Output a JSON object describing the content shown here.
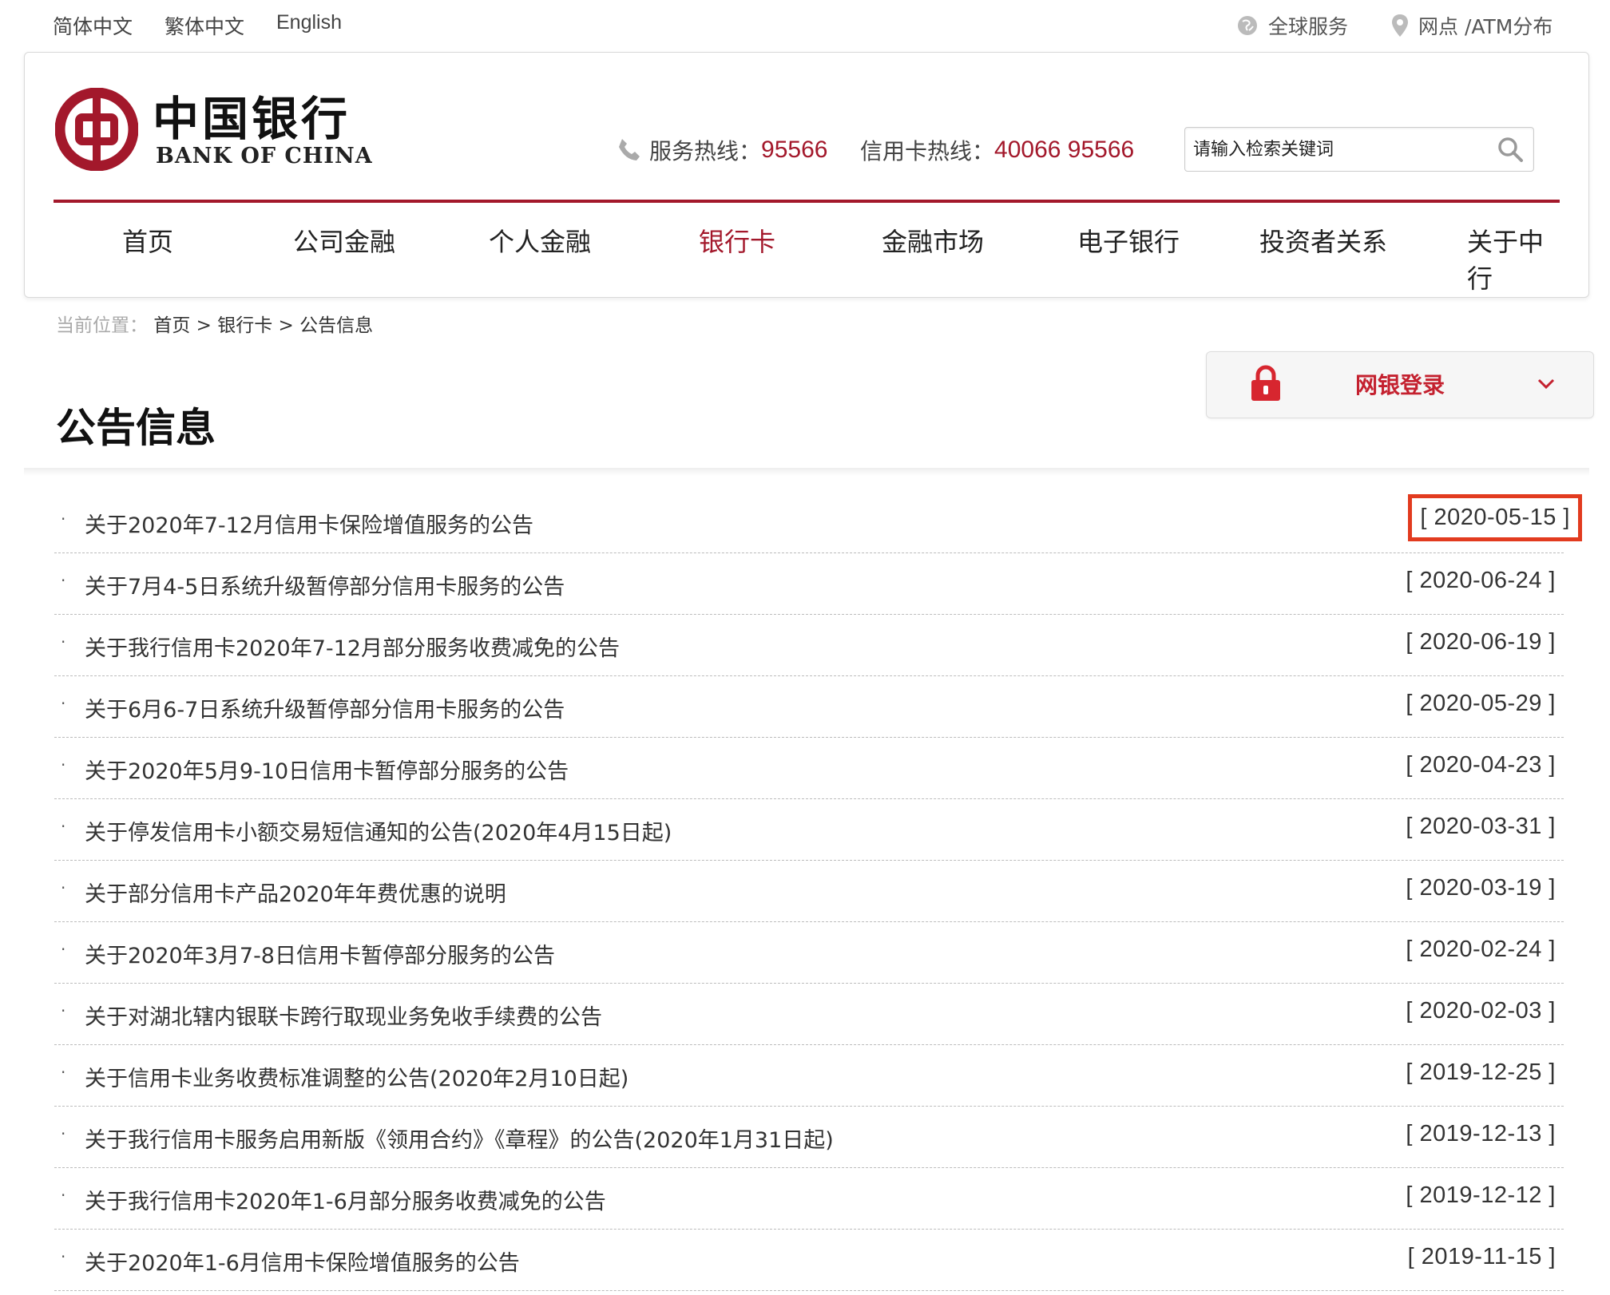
{
  "topbar": {
    "languages": [
      "简体中文",
      "繁体中文",
      "English"
    ],
    "global_service": "全球服务",
    "atm": "网点 /ATM分布"
  },
  "header": {
    "logo_cn": "中国银行",
    "logo_en": "BANK OF CHINA",
    "service_hotline_label": "服务热线：",
    "service_hotline_number": "95566",
    "credit_hotline_label": "信用卡热线：",
    "credit_hotline_number": "40066 95566",
    "search_placeholder": "请输入检索关键词"
  },
  "nav": {
    "items": [
      "首页",
      "公司金融",
      "个人金融",
      "银行卡",
      "金融市场",
      "电子银行",
      "投资者关系",
      "关于中行"
    ],
    "active_index": 3
  },
  "breadcrumb": {
    "prefix": "当前位置：",
    "path": "首页 > 银行卡 > 公告信息"
  },
  "login": {
    "label": "网银登录"
  },
  "page_title": "公告信息",
  "announcements": [
    {
      "title": "关于2020年7-12月信用卡保险增值服务的公告",
      "date": "[ 2020-05-15 ]",
      "highlighted": true
    },
    {
      "title": "关于7月4-5日系统升级暂停部分信用卡服务的公告",
      "date": "[ 2020-06-24 ]"
    },
    {
      "title": "关于我行信用卡2020年7-12月部分服务收费减免的公告",
      "date": "[ 2020-06-19 ]"
    },
    {
      "title": "关于6月6-7日系统升级暂停部分信用卡服务的公告",
      "date": "[ 2020-05-29 ]"
    },
    {
      "title": "关于2020年5月9-10日信用卡暂停部分服务的公告",
      "date": "[ 2020-04-23 ]"
    },
    {
      "title": "关于停发信用卡小额交易短信通知的公告(2020年4月15日起)",
      "date": "[ 2020-03-31 ]"
    },
    {
      "title": "关于部分信用卡产品2020年年费优惠的说明",
      "date": "[ 2020-03-19 ]"
    },
    {
      "title": "关于2020年3月7-8日信用卡暂停部分服务的公告",
      "date": "[ 2020-02-24 ]"
    },
    {
      "title": "关于对湖北辖内银联卡跨行取现业务免收手续费的公告",
      "date": "[ 2020-02-03 ]"
    },
    {
      "title": "关于信用卡业务收费标准调整的公告(2020年2月10日起)",
      "date": "[ 2019-12-25 ]"
    },
    {
      "title": "关于我行信用卡服务启用新版《领用合约》《章程》的公告(2020年1月31日起)",
      "date": "[ 2019-12-13 ]"
    },
    {
      "title": "关于我行信用卡2020年1-6月部分服务收费减免的公告",
      "date": "[ 2019-12-12 ]"
    },
    {
      "title": "关于2020年1-6月信用卡保险增值服务的公告",
      "date": "[ 2019-11-15 ]"
    }
  ],
  "colors": {
    "brand_red": "#a3182b",
    "highlight_box": "#e23b1f"
  }
}
